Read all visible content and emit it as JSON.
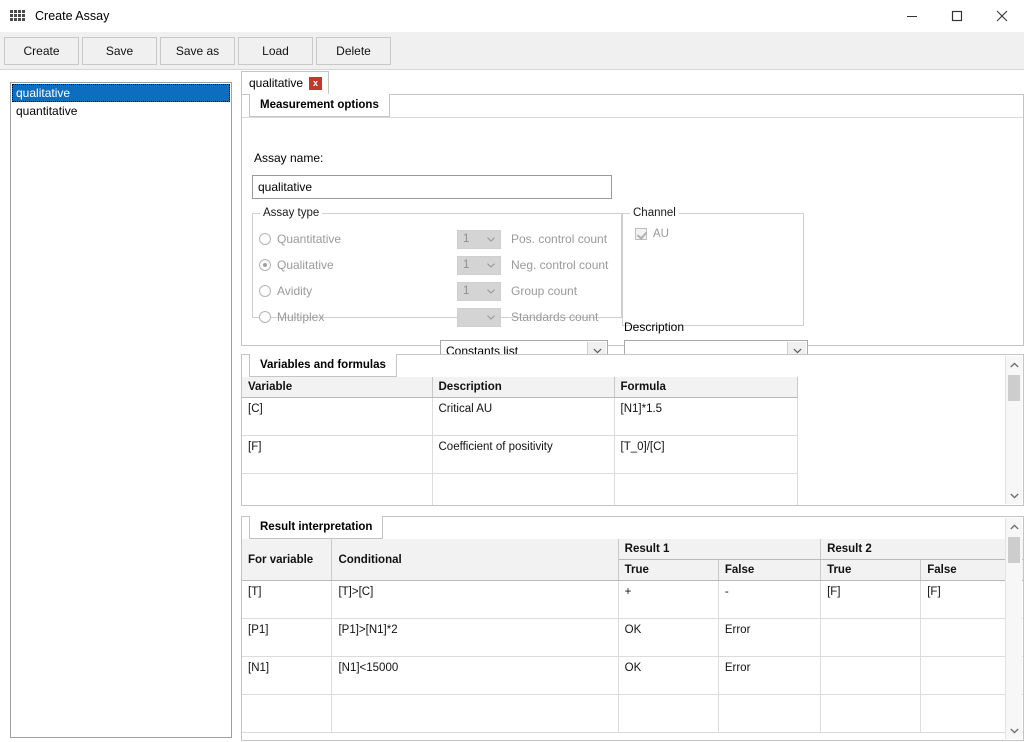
{
  "window": {
    "title": "Create Assay",
    "icon": "grid-dots-icon",
    "controls": {
      "minimize": "minimize-icon",
      "maximize": "maximize-icon",
      "close": "close-icon"
    }
  },
  "toolbar": {
    "buttons": [
      "Create",
      "Save",
      "Save as",
      "Load",
      "Delete"
    ]
  },
  "assay_list": {
    "items": [
      {
        "label": "qualitative",
        "selected": true
      },
      {
        "label": "quantitative",
        "selected": false
      }
    ]
  },
  "document_tab": {
    "label": "qualitative",
    "close_label": "x"
  },
  "measurement_options": {
    "tab_label": "Measurement options",
    "assay_name_label": "Assay name:",
    "assay_name_value": "qualitative",
    "assay_name_placeholder": "",
    "assay_type": {
      "caption": "Assay type",
      "options": [
        {
          "label": "Quantitative",
          "selected": false,
          "count": "1",
          "count_label": "Pos. control count"
        },
        {
          "label": "Qualitative",
          "selected": true,
          "count": "1",
          "count_label": "Neg. control count"
        },
        {
          "label": "Avidity",
          "selected": false,
          "count": "1",
          "count_label": "Group count"
        },
        {
          "label": "Multiplex",
          "selected": false,
          "count": "",
          "count_label": "Standards count"
        }
      ]
    },
    "channel": {
      "caption": "Channel",
      "items": [
        {
          "label": "AU",
          "checked": true
        }
      ]
    },
    "description_label": "Description",
    "constants_combo_value": "Constants list",
    "description_combo_value": ""
  },
  "variables_formulas": {
    "tab_label": "Variables and formulas",
    "columns": [
      "Variable",
      "Description",
      "Formula"
    ],
    "rows": [
      [
        "[C]",
        "Critical AU",
        "[N1]*1.5"
      ],
      [
        "[F]",
        "Coefficient of positivity",
        "[T_0]/[C]"
      ],
      [
        "",
        "",
        ""
      ]
    ]
  },
  "result_interpretation": {
    "tab_label": "Result interpretation",
    "columns": {
      "for_variable": "For variable",
      "conditional": "Conditional",
      "result1": "Result 1",
      "result2": "Result 2",
      "true": "True",
      "false": "False"
    },
    "rows": [
      {
        "for_variable": "[T]",
        "conditional": "[T]>[C]",
        "r1_true": "+",
        "r1_false": "-",
        "r2_true": "[F]",
        "r2_false": "[F]"
      },
      {
        "for_variable": "[P1]",
        "conditional": "[P1]>[N1]*2",
        "r1_true": "OK",
        "r1_false": "Error",
        "r2_true": "",
        "r2_false": ""
      },
      {
        "for_variable": "[N1]",
        "conditional": "[N1]<15000",
        "r1_true": "OK",
        "r1_false": "Error",
        "r2_true": "",
        "r2_false": ""
      },
      {
        "for_variable": "",
        "conditional": "",
        "r1_true": "",
        "r1_false": "",
        "r2_true": "",
        "r2_false": ""
      }
    ]
  },
  "colors": {
    "selection": "#0d6ebf",
    "tab_close": "#c0392b",
    "toolbar_bg": "#f0f0f0",
    "header_bg": "#f2f2f2"
  }
}
